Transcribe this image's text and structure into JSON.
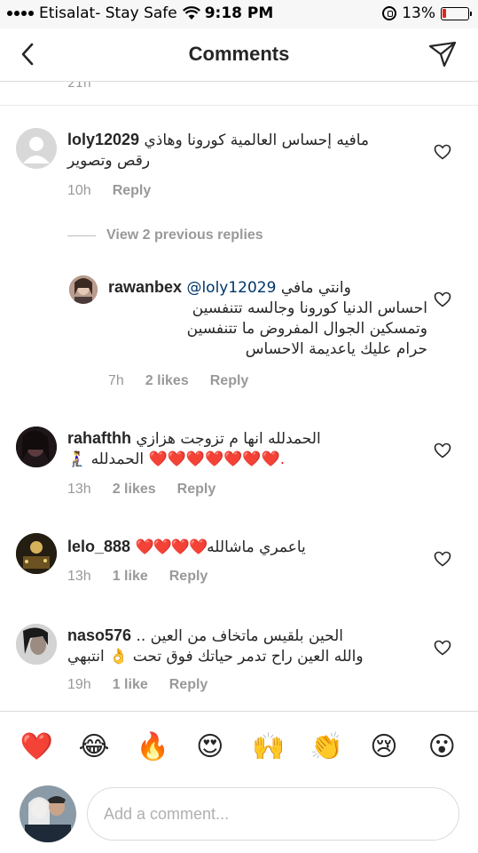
{
  "status_bar": {
    "carrier": "Etisalat- Stay Safe",
    "time": "9:18 PM",
    "battery": "13%",
    "battery_level": 0.13
  },
  "header": {
    "title": "Comments",
    "back_icon": "chevron-left-icon",
    "send_icon": "paper-plane-icon"
  },
  "comments": [
    {
      "username": "loly12029",
      "text_line1": "مافيه إحساس العالمية كورونا وهاذي",
      "text_line2": "رقص وتصوير",
      "time": "10h",
      "reply": "Reply"
    },
    {
      "username": "rawanbex",
      "mention": "@loly12029",
      "text_line1": "وانتي مافي",
      "text_line2": "احساس الدنيا كورونا وجالسه تتنفسين",
      "text_line3": "وتمسكين الجوال المفروض ما تتنفسين",
      "text_line4": "حرام عليك ياعديمة الاحساس",
      "time": "7h",
      "likes": "2 likes",
      "reply": "Reply"
    },
    {
      "username": "rahafthh",
      "text_line1": "الحمدلله انها م تزوجت هزازي",
      "text_line2_hearts": "❤️❤️❤️❤️❤️❤️❤️.",
      "text_line2_text": "الحمدلله 🧎‍♀️",
      "time": "13h",
      "likes": "2 likes",
      "reply": "Reply"
    },
    {
      "username": "lelo_888",
      "hearts": "❤️❤️❤️❤️",
      "text_line1": "ياعمري ماشالله",
      "time": "13h",
      "likes": "1 like",
      "reply": "Reply"
    },
    {
      "username": "naso576",
      "text_line1": "الحين بلقيس ماتخاف من العين ..",
      "text_line2": "والله العين راح تدمر حياتك فوق تحت 👌 انتبهي",
      "time": "19h",
      "likes": "1 like",
      "reply": "Reply"
    }
  ],
  "view_replies": "View 2 previous replies",
  "partial_timestamp": "21h",
  "emojis": [
    "❤️",
    "😂",
    "🔥",
    "😍",
    "🙌",
    "👏",
    "😢",
    "😮"
  ],
  "add_comment": {
    "placeholder": "Add a comment..."
  },
  "colors": {
    "accent_heart": "#ed1c24",
    "text": "#262626",
    "muted": "#999999",
    "mention": "#003569"
  }
}
